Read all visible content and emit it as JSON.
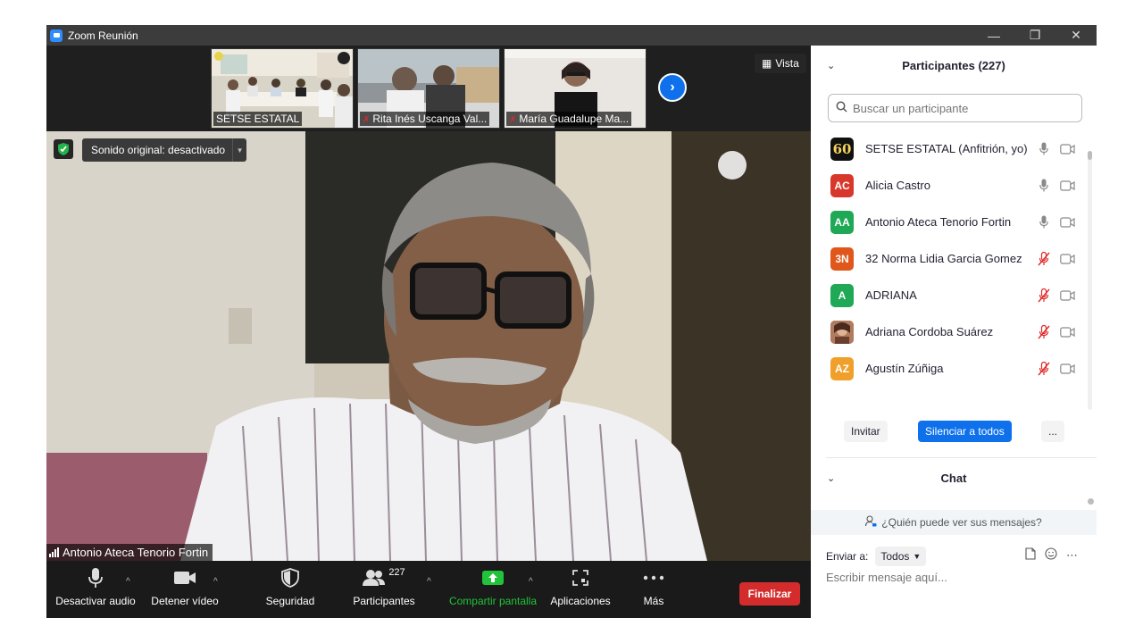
{
  "window": {
    "title": "Zoom Reunión",
    "minimize_icon": "minimize-icon",
    "restore_icon": "restore-icon",
    "close_icon": "close-icon"
  },
  "thumbnails": [
    {
      "name": "SETSE ESTATAL",
      "muted": false
    },
    {
      "name": "Rita Inés Uscanga Val...",
      "muted": true
    },
    {
      "name": "María Guadalupe Ma...",
      "muted": true
    }
  ],
  "view_button": {
    "label": "Vista"
  },
  "main_video": {
    "speaker_name": "Antonio Ateca Tenorio Fortin",
    "original_sound": "Sonido original: desactivado"
  },
  "toolbar": {
    "mute_label": "Desactivar audio",
    "video_label": "Detener vídeo",
    "security_label": "Seguridad",
    "participants_label": "Participantes",
    "participants_count": "227",
    "share_label": "Compartir pantalla",
    "apps_label": "Aplicaciones",
    "more_label": "Más",
    "end_label": "Finalizar"
  },
  "participants_panel": {
    "title": "Participantes (227)",
    "search_placeholder": "Buscar un participante",
    "items": [
      {
        "name": "SETSE ESTATAL (Anfitrión, yo)",
        "initials": "60",
        "color": "#111111",
        "muted": false
      },
      {
        "name": "Alicia Castro",
        "initials": "AC",
        "color": "#d8372b",
        "muted": false
      },
      {
        "name": "Antonio Ateca Tenorio Fortin",
        "initials": "AA",
        "color": "#1fa855",
        "muted": false
      },
      {
        "name": "32 Norma Lidia Garcia Gomez",
        "initials": "3N",
        "color": "#e0561b",
        "muted": true
      },
      {
        "name": "ADRIANA",
        "initials": "A",
        "color": "#1fa855",
        "muted": true
      },
      {
        "name": "Adriana Cordoba Suárez",
        "initials": "",
        "color": "#8a5a44",
        "muted": true
      },
      {
        "name": "Agustín Zúñiga",
        "initials": "AZ",
        "color": "#f0a02a",
        "muted": true
      }
    ],
    "invite_label": "Invitar",
    "mute_all_label": "Silenciar a todos",
    "more_label": "..."
  },
  "chat_panel": {
    "title": "Chat",
    "who_can_see": "¿Quién puede ver sus mensajes?",
    "send_to_label": "Enviar a:",
    "recipient": "Todos",
    "input_placeholder": "Escribir mensaje aquí..."
  },
  "colors": {
    "accent": "#0e71eb",
    "danger": "#d42c2c",
    "share_green": "#21c33a"
  }
}
